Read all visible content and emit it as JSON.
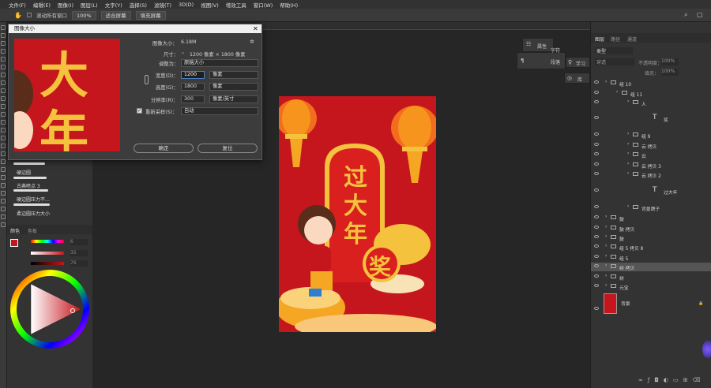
{
  "menu": [
    "文件(F)",
    "编辑(E)",
    "图像(I)",
    "图层(L)",
    "文字(Y)",
    "选择(S)",
    "滤镜(T)",
    "3D(D)",
    "视图(V)",
    "增效工具",
    "窗口(W)",
    "帮助(H)"
  ],
  "options": {
    "scroll_all": "滚动所有窗口",
    "zoom": "100%",
    "fit": "适合屏幕",
    "fill": "填充屏幕"
  },
  "dialog": {
    "title": "图像大小",
    "size_label": "图像大小：",
    "size_value": "6.18M",
    "dim_label": "尺寸：",
    "dim_value": "1200 像素 × 1800 像素",
    "fit_label": "调整为：",
    "fit_value": "原稿大小",
    "width_label": "宽度(D)：",
    "width_value": "1200",
    "width_unit": "像素",
    "height_label": "高度(G)：",
    "height_value": "1800",
    "height_unit": "像素",
    "res_label": "分辨率(R)：",
    "res_value": "300",
    "res_unit": "像素/英寸",
    "resample_label": "重新采样(S)：",
    "resample_value": "自动",
    "ok": "确定",
    "reset": "复位",
    "preview_chars": [
      "大",
      "年"
    ]
  },
  "brushes": [
    "硬边圆",
    "古典喷点 3",
    "硬边圆压力不…",
    "柔边圆压力大小"
  ],
  "color_panel": {
    "tab1": "颜色",
    "tab2": "色板",
    "r": "6",
    "g": "35",
    "b": "76",
    "fg": "#c4161c",
    "bg": "#ffffff"
  },
  "float_panels": {
    "props": "属性",
    "char": "字符",
    "para": "段落",
    "learn": "学习",
    "lib": "库"
  },
  "right_tabs": [
    "图层",
    "路径",
    "通道"
  ],
  "layer_filters": {
    "kind": "类型",
    "mode": "穿透",
    "opacity_label": "不透明度：",
    "opacity": "100%",
    "fill_label": "填充：",
    "fill": "100%"
  },
  "layers": [
    {
      "name": "组 10",
      "indent": 0,
      "type": "folder"
    },
    {
      "name": "组 11",
      "indent": 1,
      "type": "folder"
    },
    {
      "name": "人",
      "indent": 2,
      "type": "folder"
    },
    {
      "name": "奖",
      "indent": 2,
      "type": "text"
    },
    {
      "name": "组 9",
      "indent": 2,
      "type": "folder"
    },
    {
      "name": "云 拷贝",
      "indent": 2,
      "type": "folder"
    },
    {
      "name": "云",
      "indent": 2,
      "type": "folder"
    },
    {
      "name": "云 拷贝 3",
      "indent": 2,
      "type": "folder"
    },
    {
      "name": "云 拷贝 2",
      "indent": 2,
      "type": "folder"
    },
    {
      "name": "过大年",
      "indent": 2,
      "type": "text"
    },
    {
      "name": "背景牌子",
      "indent": 2,
      "type": "folder"
    },
    {
      "name": "鼓",
      "indent": 0,
      "type": "folder"
    },
    {
      "name": "鼓 拷贝",
      "indent": 0,
      "type": "folder"
    },
    {
      "name": "鼓",
      "indent": 0,
      "type": "folder"
    },
    {
      "name": "组 5 拷贝 8",
      "indent": 0,
      "type": "folder"
    },
    {
      "name": "组 5",
      "indent": 0,
      "type": "folder"
    },
    {
      "name": "树 拷贝",
      "indent": 0,
      "type": "folder"
    },
    {
      "name": "树",
      "indent": 0,
      "type": "folder"
    },
    {
      "name": "元宝",
      "indent": 0,
      "type": "folder"
    },
    {
      "name": "背景",
      "indent": 0,
      "type": "bg"
    }
  ],
  "poster": {
    "title_chars": [
      "过",
      "大",
      "年"
    ],
    "prize": "奖",
    "bg": "#c4161c",
    "gold": "#f5c23e"
  },
  "icons": [
    "move-tool-icon",
    "brush-icon",
    "eye-icon",
    "folder-icon",
    "lock-icon",
    "gear-icon"
  ]
}
